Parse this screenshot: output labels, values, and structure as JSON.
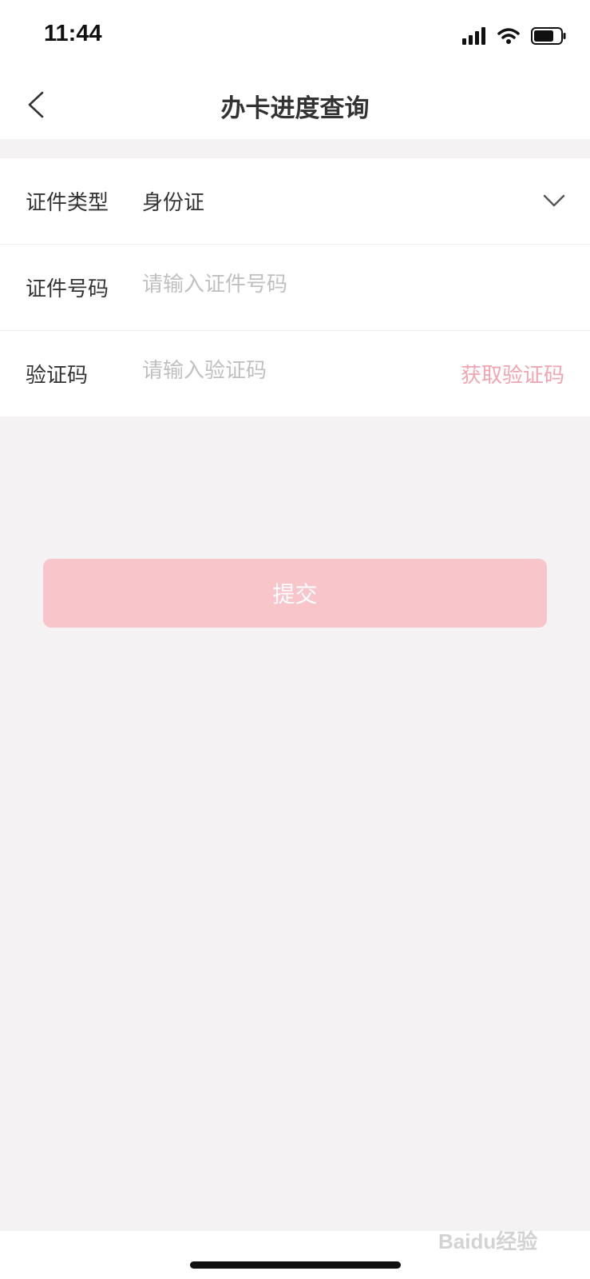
{
  "status_bar": {
    "time": "11:44"
  },
  "nav": {
    "title": "办卡进度查询"
  },
  "form": {
    "id_type": {
      "label": "证件类型",
      "value": "身份证"
    },
    "id_number": {
      "label": "证件号码",
      "placeholder": "请输入证件号码"
    },
    "captcha": {
      "label": "验证码",
      "placeholder": "请输入验证码",
      "get_code_label": "获取验证码"
    }
  },
  "submit": {
    "label": "提交"
  },
  "watermark": {
    "text": "Baidu经验"
  },
  "colors": {
    "accent": "#f0a5b0",
    "submit_bg": "#f7c5ca",
    "page_bg": "#f4f2f3"
  },
  "icons": {
    "back": "chevron-left-icon",
    "dropdown": "chevron-down-icon"
  }
}
